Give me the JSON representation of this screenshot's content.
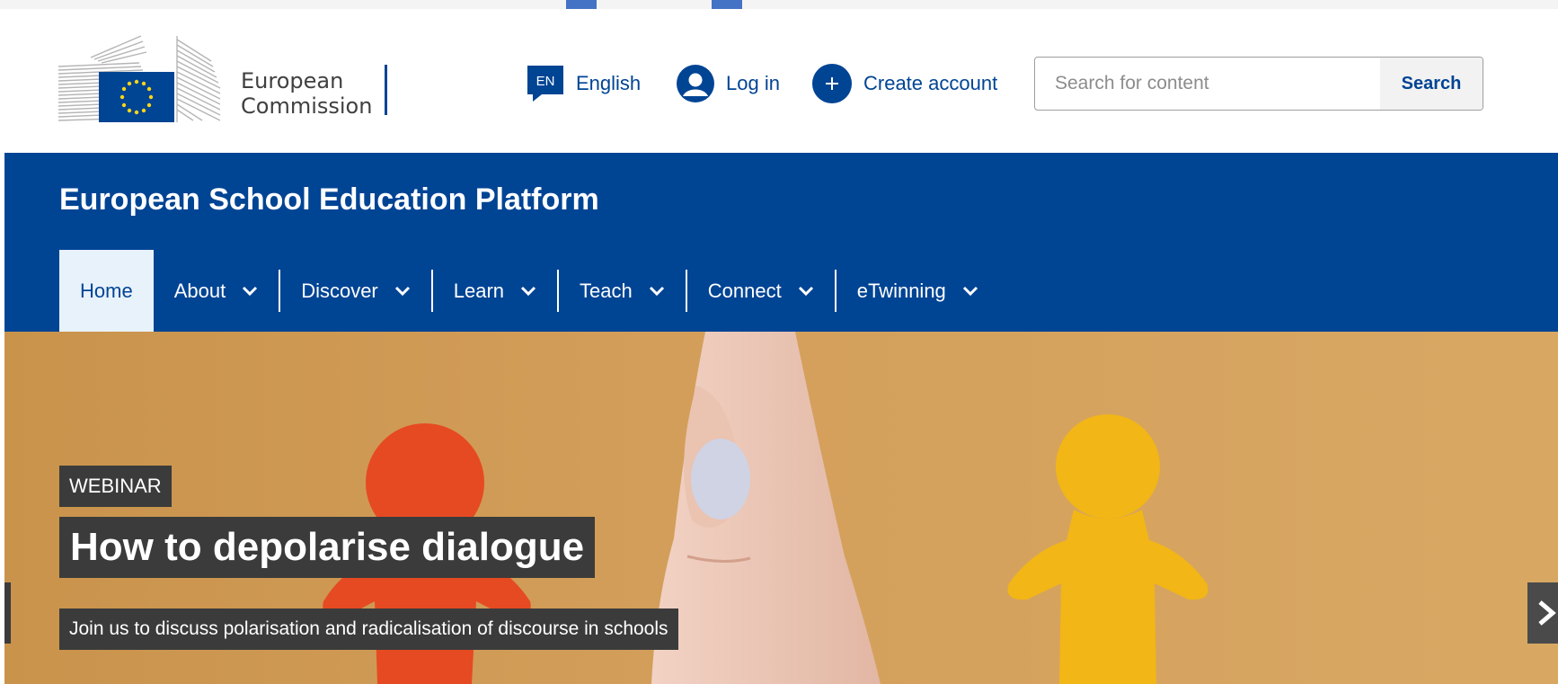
{
  "header": {
    "logo": {
      "line1": "European",
      "line2": "Commission"
    },
    "language": {
      "code": "EN",
      "label": "English"
    },
    "login_label": "Log in",
    "create_account_label": "Create account",
    "search": {
      "placeholder": "Search for content",
      "button_label": "Search"
    }
  },
  "site": {
    "title": "European School Education Platform",
    "menu": [
      {
        "label": "Home",
        "active": true
      },
      {
        "label": "About",
        "dropdown": true
      },
      {
        "label": "Discover",
        "dropdown": true
      },
      {
        "label": "Learn",
        "dropdown": true
      },
      {
        "label": "Teach",
        "dropdown": true
      },
      {
        "label": "Connect",
        "dropdown": true
      },
      {
        "label": "eTwinning",
        "dropdown": true
      }
    ]
  },
  "hero": {
    "tag": "WEBINAR",
    "title": "How to depolarise dialogue",
    "description": "Join us to discuss polarisation and radicalisation of discourse in schools"
  },
  "colors": {
    "brand_blue": "#004494",
    "menu_active_bg": "#e8f2fb",
    "annotation_arrow": "#4472c4",
    "hero_bg": "#cf9b55",
    "caption_bg": "#3b3b3b"
  },
  "icons": {
    "language": "speech-bubble-icon",
    "login": "user-icon",
    "create_account": "plus-circle-icon",
    "menu_dropdown": "chevron-down-icon",
    "carousel_next": "chevron-right-icon"
  }
}
